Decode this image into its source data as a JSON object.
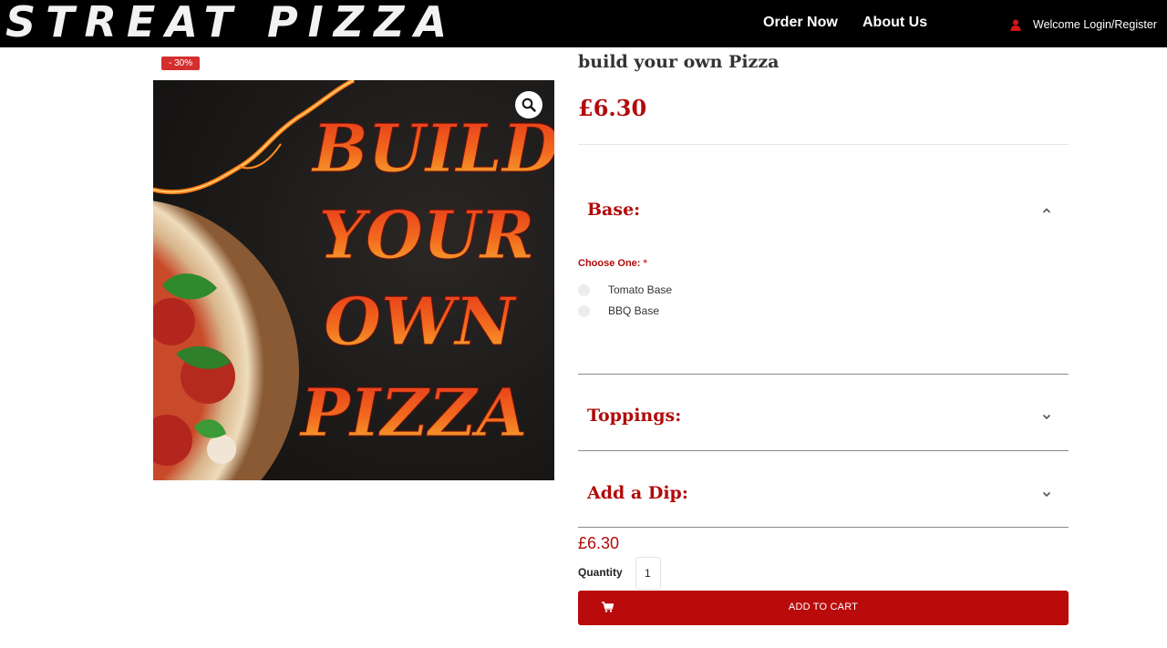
{
  "header": {
    "logo_text": "STREAT PIZZA",
    "nav": {
      "order_now": "Order Now",
      "about_us": "About Us"
    },
    "account_label": "Welcome Login/Register"
  },
  "gallery": {
    "sale_badge": "- 30%",
    "image_text": [
      "BUILD",
      "YOUR",
      "OWN",
      "PIZZA"
    ]
  },
  "product": {
    "title": "build your own Pizza",
    "price": "£6.30",
    "sections": [
      {
        "label": "Base:",
        "expanded": true
      },
      {
        "label": "Toppings:",
        "expanded": false
      },
      {
        "label": "Add a Dip:",
        "expanded": false
      }
    ],
    "base": {
      "choose_label": "Choose One:",
      "required_marker": "*",
      "options": [
        "Tomato Base",
        "BBQ Base"
      ]
    },
    "total_price": "£6.30",
    "quantity_label": "Quantity",
    "quantity_value": "1",
    "add_to_cart_label": "ADD TO CART"
  },
  "colors": {
    "accent": "#b10b0b",
    "header_bg": "#000000",
    "badge": "#d32f2f"
  },
  "icons": [
    "user-icon",
    "magnifier-icon",
    "chevron-up-icon",
    "chevron-down-icon",
    "cart-icon"
  ]
}
